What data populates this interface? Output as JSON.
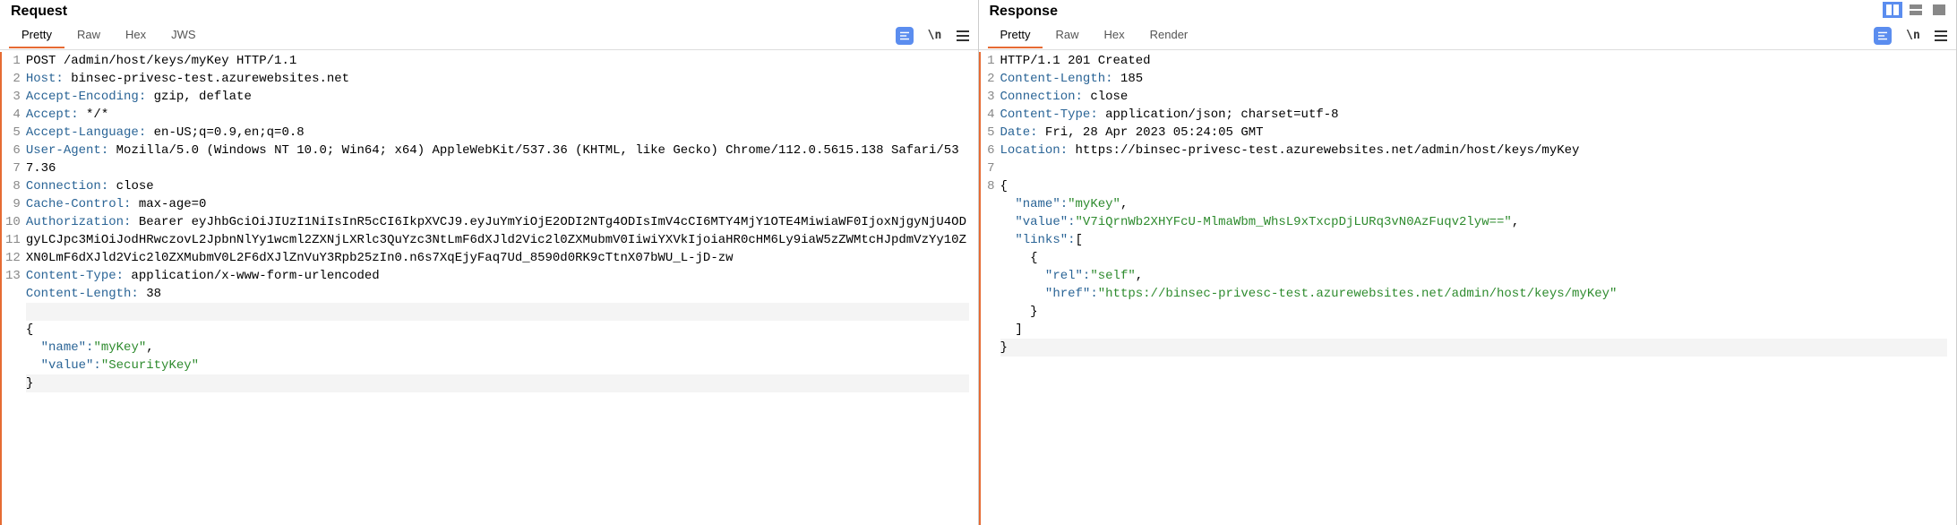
{
  "request": {
    "title": "Request",
    "tabs": [
      "Pretty",
      "Raw",
      "Hex",
      "JWS"
    ],
    "activeTab": 0,
    "lines": [
      {
        "n": "1",
        "segs": [
          {
            "t": "POST /admin/host/keys/myKey HTTP/1.1",
            "c": "hl-black"
          }
        ]
      },
      {
        "n": "2",
        "segs": [
          {
            "t": "Host:",
            "c": "hl-header"
          },
          {
            "t": " binsec-privesc-test.azurewebsites.net",
            "c": "hl-black"
          }
        ]
      },
      {
        "n": "3",
        "segs": [
          {
            "t": "Accept-Encoding:",
            "c": "hl-header"
          },
          {
            "t": " gzip, deflate",
            "c": "hl-black"
          }
        ]
      },
      {
        "n": "4",
        "segs": [
          {
            "t": "Accept:",
            "c": "hl-header"
          },
          {
            "t": " */*",
            "c": "hl-black"
          }
        ]
      },
      {
        "n": "5",
        "segs": [
          {
            "t": "Accept-Language:",
            "c": "hl-header"
          },
          {
            "t": " en-US;q=0.9,en;q=0.8",
            "c": "hl-black"
          }
        ]
      },
      {
        "n": "6",
        "segs": [
          {
            "t": "User-Agent:",
            "c": "hl-header"
          },
          {
            "t": " Mozilla/5.0 (Windows NT 10.0; Win64; x64) AppleWebKit/537.36 (KHTML, like Gecko) Chrome/112.0.5615.138 Safari/537.36",
            "c": "hl-black"
          }
        ]
      },
      {
        "n": "7",
        "segs": [
          {
            "t": "Connection:",
            "c": "hl-header"
          },
          {
            "t": " close",
            "c": "hl-black"
          }
        ]
      },
      {
        "n": "8",
        "segs": [
          {
            "t": "Cache-Control:",
            "c": "hl-header"
          },
          {
            "t": " max-age=0",
            "c": "hl-black"
          }
        ]
      },
      {
        "n": "9",
        "segs": [
          {
            "t": "Authorization:",
            "c": "hl-header"
          },
          {
            "t": " Bearer eyJhbGciOiJIUzI1NiIsInR5cCI6IkpXVCJ9.eyJuYmYiOjE2ODI2NTg4ODIsImV4cCI6MTY4MjY1OTE4MiwiaWF0IjoxNjgyNjU4ODgyLCJpc3MiOiJodHRwczovL2JpbnNlYy1wcml2ZXNjLXRlc3QuYzc3NtLmF6dXJld2Vic2l0ZXMubmV0IiwiYXVkIjoiaHR0cHM6Ly9iaW5zZWMtcHJpdmVzYy10ZXN0LmF6dXJld2Vic2l0ZXMubmV0L2F6dXJlZnVuY3Rpb25zIn0.n6s7XqEjyFaq7Ud_8590d0RK9cTtnX07bWU_L-jD-zw",
            "c": "hl-black"
          }
        ]
      },
      {
        "n": "10",
        "segs": [
          {
            "t": "Content-Type:",
            "c": "hl-header"
          },
          {
            "t": " application/x-www-form-urlencoded",
            "c": "hl-black"
          }
        ]
      },
      {
        "n": "11",
        "segs": [
          {
            "t": "Content-Length:",
            "c": "hl-header"
          },
          {
            "t": " 38",
            "c": "hl-black"
          }
        ]
      },
      {
        "n": "12",
        "segs": [
          {
            "t": "",
            "c": "hl-black"
          }
        ],
        "alt": true
      },
      {
        "n": "13",
        "segs": [
          {
            "t": "{",
            "c": "hl-black"
          }
        ]
      },
      {
        "n": "",
        "segs": [
          {
            "t": "  \"name\":",
            "c": "hl-header"
          },
          {
            "t": "\"myKey\"",
            "c": "hl-string"
          },
          {
            "t": ",",
            "c": "hl-black"
          }
        ]
      },
      {
        "n": "",
        "segs": [
          {
            "t": "  \"value\":",
            "c": "hl-header"
          },
          {
            "t": "\"SecurityKey\"",
            "c": "hl-string"
          }
        ]
      },
      {
        "n": "",
        "segs": [
          {
            "t": "}",
            "c": "hl-black"
          }
        ],
        "alt": true
      }
    ]
  },
  "response": {
    "title": "Response",
    "tabs": [
      "Pretty",
      "Raw",
      "Hex",
      "Render"
    ],
    "activeTab": 0,
    "lines": [
      {
        "n": "1",
        "segs": [
          {
            "t": "HTTP/1.1 201 Created",
            "c": "hl-black"
          }
        ]
      },
      {
        "n": "2",
        "segs": [
          {
            "t": "Content-Length:",
            "c": "hl-header"
          },
          {
            "t": " 185",
            "c": "hl-black"
          }
        ]
      },
      {
        "n": "3",
        "segs": [
          {
            "t": "Connection:",
            "c": "hl-header"
          },
          {
            "t": " close",
            "c": "hl-black"
          }
        ]
      },
      {
        "n": "4",
        "segs": [
          {
            "t": "Content-Type:",
            "c": "hl-header"
          },
          {
            "t": " application/json; charset=utf-8",
            "c": "hl-black"
          }
        ]
      },
      {
        "n": "5",
        "segs": [
          {
            "t": "Date:",
            "c": "hl-header"
          },
          {
            "t": " Fri, 28 Apr 2023 05:24:05 GMT",
            "c": "hl-black"
          }
        ]
      },
      {
        "n": "6",
        "segs": [
          {
            "t": "Location:",
            "c": "hl-header"
          },
          {
            "t": " https://binsec-privesc-test.azurewebsites.net/admin/host/keys/myKey",
            "c": "hl-black"
          }
        ]
      },
      {
        "n": "7",
        "segs": [
          {
            "t": "",
            "c": "hl-black"
          }
        ]
      },
      {
        "n": "8",
        "segs": [
          {
            "t": "{",
            "c": "hl-black"
          }
        ]
      },
      {
        "n": "",
        "segs": [
          {
            "t": "  \"name\":",
            "c": "hl-header"
          },
          {
            "t": "\"myKey\"",
            "c": "hl-string"
          },
          {
            "t": ",",
            "c": "hl-black"
          }
        ]
      },
      {
        "n": "",
        "segs": [
          {
            "t": "  \"value\":",
            "c": "hl-header"
          },
          {
            "t": "\"V7iQrnWb2XHYFcU-MlmaWbm_WhsL9xTxcpDjLURq3vN0AzFuqv2lyw==\"",
            "c": "hl-string"
          },
          {
            "t": ",",
            "c": "hl-black"
          }
        ]
      },
      {
        "n": "",
        "segs": [
          {
            "t": "  \"links\":",
            "c": "hl-header"
          },
          {
            "t": "[",
            "c": "hl-black"
          }
        ]
      },
      {
        "n": "",
        "segs": [
          {
            "t": "    {",
            "c": "hl-black"
          }
        ]
      },
      {
        "n": "",
        "segs": [
          {
            "t": "      \"rel\":",
            "c": "hl-header"
          },
          {
            "t": "\"self\"",
            "c": "hl-string"
          },
          {
            "t": ",",
            "c": "hl-black"
          }
        ]
      },
      {
        "n": "",
        "segs": [
          {
            "t": "      \"href\":",
            "c": "hl-header"
          },
          {
            "t": "\"https://binsec-privesc-test.azurewebsites.net/admin/host/keys/myKey\"",
            "c": "hl-string"
          }
        ]
      },
      {
        "n": "",
        "segs": [
          {
            "t": "    }",
            "c": "hl-black"
          }
        ]
      },
      {
        "n": "",
        "segs": [
          {
            "t": "  ]",
            "c": "hl-black"
          }
        ]
      },
      {
        "n": "",
        "segs": [
          {
            "t": "}",
            "c": "hl-black"
          }
        ],
        "alt": true
      }
    ]
  },
  "toolIcons": {
    "equals": "≡",
    "newline": "\\n"
  }
}
